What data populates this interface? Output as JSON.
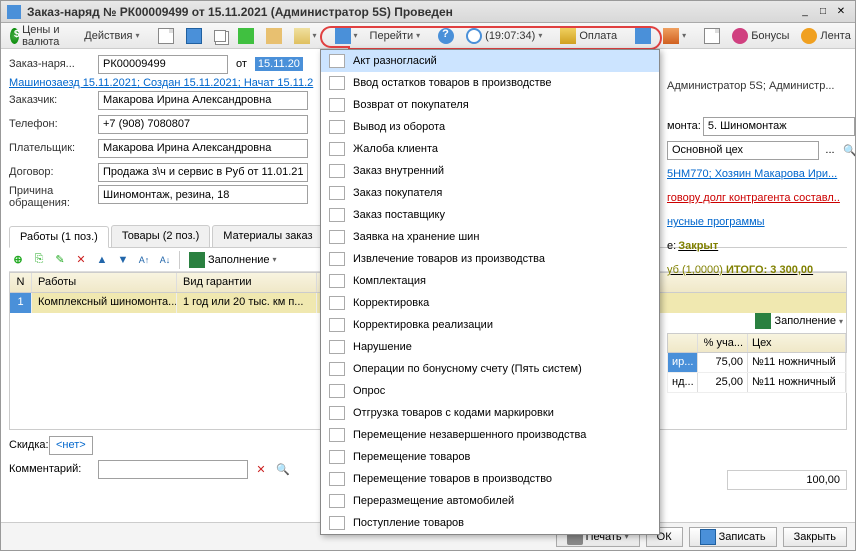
{
  "titlebar": {
    "title": "Заказ-наряд № РК00009499 от 15.11.2021 (Администратор 5S) Проведен"
  },
  "toolbar": {
    "prices": "Цены и валюта",
    "actions": "Действия",
    "goto": "Перейти",
    "time": "(19:07:34)",
    "payment": "Оплата",
    "bonuses": "Бонусы",
    "feed": "Лента"
  },
  "header": {
    "doc_label": "Заказ-наря...",
    "doc_num": "РК00009499",
    "ot": "от",
    "doc_date": "15.11.20",
    "autor": "Администратор 5S; Администр..."
  },
  "status_line": "Машинозаезд 15.11.2021; Создан 15.11.2021; Начат 15.11.2",
  "form": {
    "customer_label": "Заказчик:",
    "customer": "Макарова Ирина Александровна",
    "phone_label": "Телефон:",
    "phone": "+7 (908) 7080807",
    "payer_label": "Плательщик:",
    "payer": "Макарова Ирина Александровна",
    "contract_label": "Договор:",
    "contract": "Продажа з\\ч и сервис в Руб от 11.01.21",
    "reason_label": "Причина обращения:",
    "reason": "Шиномонтаж, резина, 18"
  },
  "right": {
    "monta_label": "монта:",
    "monta_value": "5. Шиномонтаж",
    "main_shop": "Основной цех",
    "car_link": "5НМ770; Хозяин Макарова Ири...",
    "debt_link": "говору долг контрагента составл..",
    "bonus_link": "нусные программы",
    "state_label": "е:",
    "state_value": "Закрыт",
    "totals_rub": "уб (1,0000)",
    "totals_itogo": "ИТОГО: 3 300,00"
  },
  "tabs": {
    "works": "Работы (1 поз.)",
    "goods": "Товары (2 поз.)",
    "materials": "Материалы заказ"
  },
  "sub_toolbar": {
    "fill": "Заполнение",
    "fill2": "Заполнение"
  },
  "grid": {
    "headers": {
      "n": "N",
      "works": "Работы",
      "warranty": "Вид гарантии"
    },
    "row1": {
      "n": "1",
      "work": "Комплексный шиномонта...",
      "warranty": "1 год или 20 тыс. км п..."
    }
  },
  "rgrid": {
    "headers": {
      "pct": "% уча...",
      "shop": "Цех"
    },
    "r1": {
      "who": "ир...",
      "pct": "75,00",
      "shop": "№11 ножничный"
    },
    "r2": {
      "who": "нд...",
      "pct": "25,00",
      "shop": "№11 ножничный"
    }
  },
  "discount": {
    "label": "Скидка:",
    "value": "<нет>"
  },
  "right_total": "100,00",
  "comment": {
    "label": "Комментарий:"
  },
  "footer": {
    "print": "Печать",
    "ok": "ОК",
    "save": "Записать",
    "close": "Закрыть"
  },
  "menu": [
    "Акт разногласий",
    "Ввод остатков товаров в производстве",
    "Возврат от покупателя",
    "Вывод из оборота",
    "Жалоба клиента",
    "Заказ внутренний",
    "Заказ покупателя",
    "Заказ поставщику",
    "Заявка на хранение шин",
    "Извлечение товаров из производства",
    "Комплектация",
    "Корректировка",
    "Корректировка реализации",
    "Нарушение",
    "Операции по бонусному счету (Пять систем)",
    "Опрос",
    "Отгрузка товаров с кодами маркировки",
    "Перемещение незавершенного производства",
    "Перемещение товаров",
    "Перемещение товаров в производство",
    "Переразмещение автомобилей",
    "Поступление товаров"
  ]
}
